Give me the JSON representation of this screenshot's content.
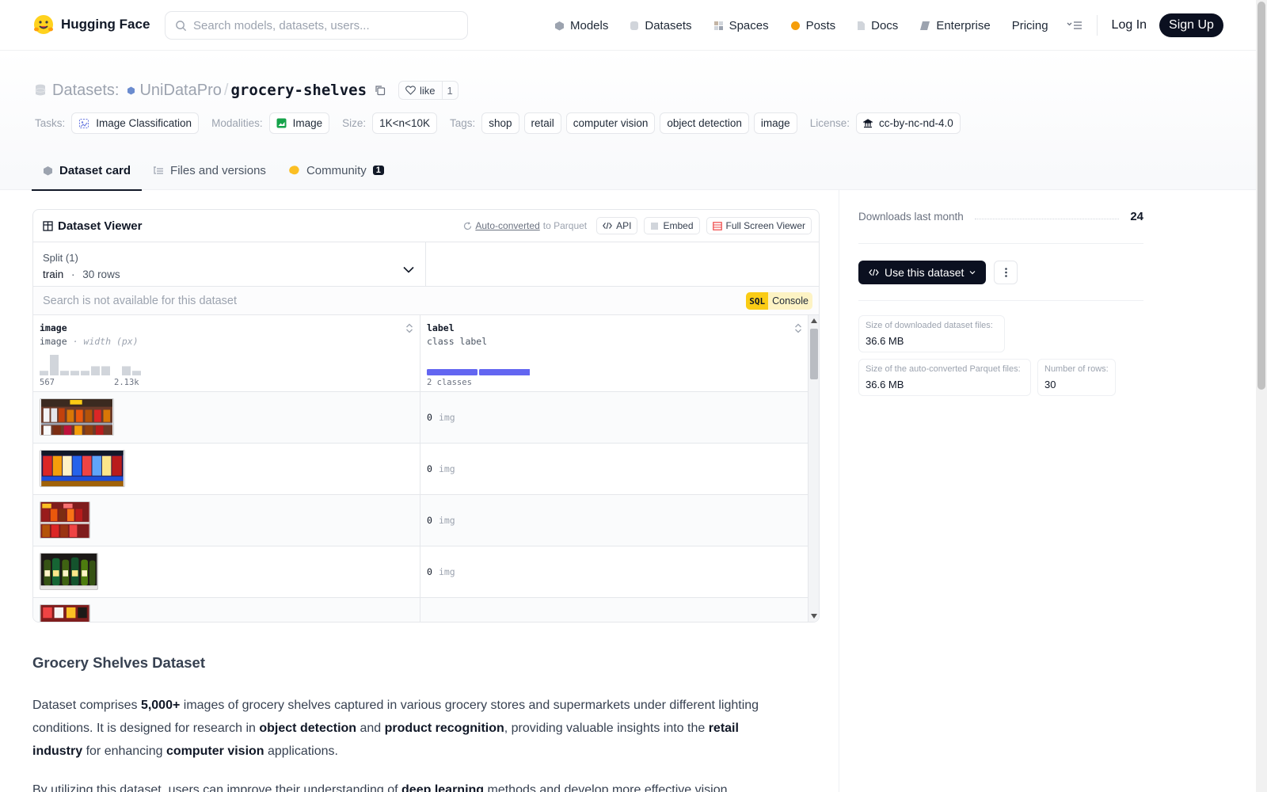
{
  "nav": {
    "brand": "Hugging Face",
    "search_placeholder": "Search models, datasets, users...",
    "links": [
      "Models",
      "Datasets",
      "Spaces",
      "Posts",
      "Docs",
      "Enterprise",
      "Pricing"
    ],
    "login": "Log In",
    "signup": "Sign Up"
  },
  "header": {
    "section": "Datasets:",
    "org": "UniDataPro",
    "repo": "grocery-shelves",
    "like_label": "like",
    "like_count": "1",
    "tasks_key": "Tasks:",
    "task": "Image Classification",
    "modalities_key": "Modalities:",
    "modality": "Image",
    "size_key": "Size:",
    "size": "1K<n<10K",
    "tags_key": "Tags:",
    "tags": [
      "shop",
      "retail",
      "computer vision",
      "object detection",
      "image"
    ],
    "license_key": "License:",
    "license": "cc-by-nc-nd-4.0"
  },
  "tabs": [
    {
      "label": "Dataset card",
      "active": true
    },
    {
      "label": "Files and versions"
    },
    {
      "label": "Community",
      "badge": "1"
    }
  ],
  "viewer": {
    "title": "Dataset Viewer",
    "auto_converted": "Auto-converted",
    "to_parquet": "to Parquet",
    "api": "API",
    "embed": "Embed",
    "fullscreen": "Full Screen Viewer",
    "split_label": "Split (1)",
    "split_name": "train",
    "split_sep": "·",
    "split_rows": "30 rows",
    "search_placeholder": "Search is not available for this dataset",
    "sql": "SQL",
    "console": "Console",
    "columns": [
      {
        "name": "image",
        "type": "image",
        "stat": "· width (px)",
        "min": "567",
        "max": "2.13k",
        "histogram": [
          2,
          9,
          2,
          2,
          2,
          4,
          4,
          0,
          4,
          2
        ]
      },
      {
        "name": "label",
        "type": "class label",
        "summary": "2 classes",
        "class_split": [
          0.5,
          0.5
        ]
      }
    ],
    "rows": [
      {
        "value": "0",
        "label": "img"
      },
      {
        "value": "0",
        "label": "img"
      },
      {
        "value": "0",
        "label": "img"
      },
      {
        "value": "0",
        "label": "img"
      }
    ]
  },
  "sidebar": {
    "downloads_label": "Downloads last month",
    "downloads": "24",
    "use_dataset": "Use this dataset",
    "stats": [
      {
        "key": "Size of downloaded dataset files:",
        "value": "36.6 MB"
      },
      {
        "key": "Size of the auto-converted Parquet files:",
        "value": "36.6 MB"
      },
      {
        "key": "Number of rows:",
        "value": "30"
      }
    ]
  },
  "readme": {
    "title": "Grocery Shelves Dataset",
    "p1": {
      "t1": "Dataset comprises ",
      "b1": "5,000+",
      "t2": " images of grocery shelves captured in various grocery stores and supermarkets under different lighting conditions. It is designed for research in ",
      "b2": "object detection",
      "t3": " and ",
      "b3": "product recognition",
      "t4": ", providing valuable insights into the ",
      "b4": "retail industry",
      "t5": " for enhancing ",
      "b5": "computer vision",
      "t6": " applications."
    },
    "p2": {
      "t1": "By utilizing this dataset, users can improve their understanding of ",
      "b1": "deep learning",
      "t2": " methods and develop more effective vision"
    }
  },
  "colors": {
    "accent": "#0b1020",
    "class_bar": "#6366f1",
    "histogram": "#d1d5db",
    "sql_badge": "#facc15"
  }
}
